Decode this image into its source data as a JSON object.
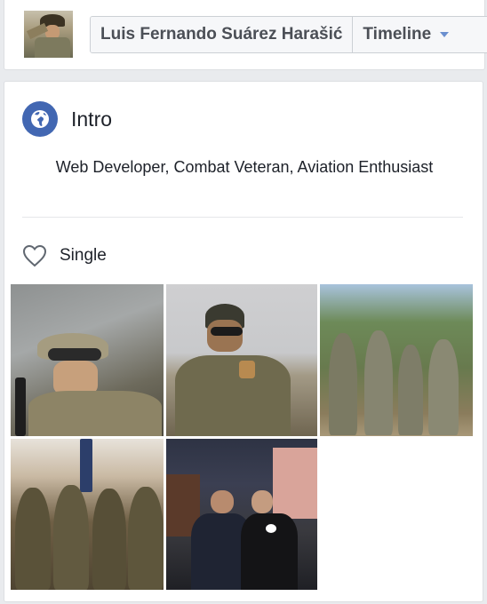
{
  "header": {
    "profile_name": "Luis Fernando Suárez Harašić",
    "timeline_label": "Timeline"
  },
  "intro": {
    "title": "Intro",
    "bio": "Web Developer, Combat Veteran, Aviation Enthusiast",
    "relationship_status": "Single"
  },
  "colors": {
    "brand_blue": "#4267b2",
    "page_background": "#e9ebee",
    "card_background": "#ffffff"
  },
  "icons": {
    "intro": "globe-icon",
    "relationship": "heart-outline-icon",
    "timeline_menu": "caret-down-icon"
  }
}
